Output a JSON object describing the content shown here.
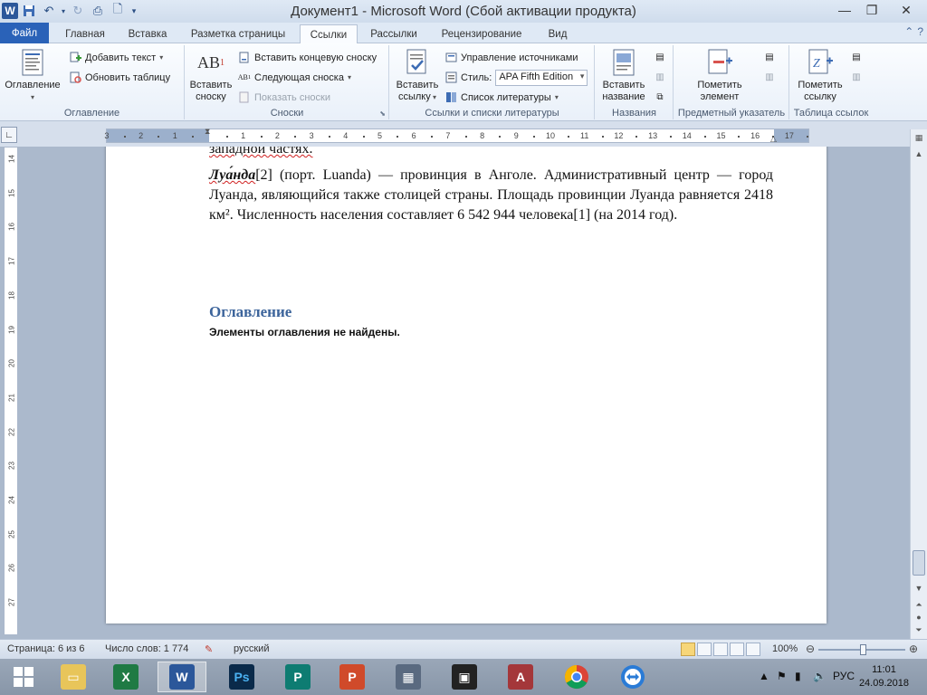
{
  "titlebar": {
    "title": "Документ1 - Microsoft Word (Сбой активации продукта)",
    "app_logo": "W"
  },
  "tabs": {
    "file": "Файл",
    "items": [
      "Главная",
      "Вставка",
      "Разметка страницы",
      "Ссылки",
      "Рассылки",
      "Рецензирование",
      "Вид"
    ],
    "active": "Ссылки"
  },
  "ribbon": {
    "toc_group": {
      "label": "Оглавление",
      "toc_button": "Оглавление",
      "add_text": "Добавить текст",
      "update_table": "Обновить таблицу"
    },
    "footnotes_group": {
      "label": "Сноски",
      "insert_footnote_line1": "Вставить",
      "insert_footnote_line2": "сноску",
      "insert_endnote": "Вставить концевую сноску",
      "next_footnote": "Следующая сноска",
      "show_notes": "Показать сноски"
    },
    "citations_group": {
      "label": "Ссылки и списки литературы",
      "insert_citation_line1": "Вставить",
      "insert_citation_line2": "ссылку",
      "manage_sources": "Управление источниками",
      "style_label": "Стиль:",
      "style_value": "APA Fifth Edition",
      "bibliography": "Список литературы"
    },
    "captions_group": {
      "label": "Названия",
      "insert_caption_line1": "Вставить",
      "insert_caption_line2": "название"
    },
    "index_group": {
      "label": "Предметный указатель",
      "mark_entry_line1": "Пометить",
      "mark_entry_line2": "элемент"
    },
    "toa_group": {
      "label": "Таблица ссылок",
      "mark_citation_line1": "Пометить",
      "mark_citation_line2": "ссылку"
    }
  },
  "ruler": {
    "h_ticks": [
      "3",
      "2",
      "1",
      "1",
      "2",
      "3",
      "4",
      "5",
      "6",
      "7",
      "8",
      "9",
      "10",
      "11",
      "12",
      "13",
      "14",
      "15",
      "16",
      "17"
    ],
    "v_ticks": [
      "14",
      "15",
      "16",
      "17",
      "18",
      "19",
      "20",
      "21",
      "22",
      "23",
      "24",
      "25",
      "26",
      "27"
    ]
  },
  "document": {
    "prev_line": "западной частях.",
    "term": "Луа́нда",
    "ref1": "[2]",
    "body_part1": " (порт. Luanda) — провинция в Анголе.          Административный центр — город Луанда, являющийся также столицей страны. Площадь провинции Луанда равняется 2418 км². Численность населения составляет 6 542 944 человека",
    "ref2": "[1]",
    "body_part2": " (на 2014 год).",
    "toc_heading": "Оглавление",
    "toc_message": "Элементы оглавления не найдены."
  },
  "statusbar": {
    "page": "Страница: 6 из 6",
    "words": "Число слов: 1 774",
    "language": "русский",
    "zoom": "100%",
    "zoom_level_percent": 100
  },
  "taskbar": {
    "apps": [
      "file-manager",
      "excel",
      "word",
      "photoshop",
      "publisher",
      "powerpoint",
      "calculator",
      "video",
      "access",
      "chrome",
      "teamviewer"
    ],
    "active_app": "word",
    "lang": "РУС",
    "time": "11:01",
    "date": "24.09.2018"
  },
  "colors": {
    "file_tab": "#2a62b8",
    "toc_heading": "#3c649b",
    "word_blue": "#2b579a"
  }
}
